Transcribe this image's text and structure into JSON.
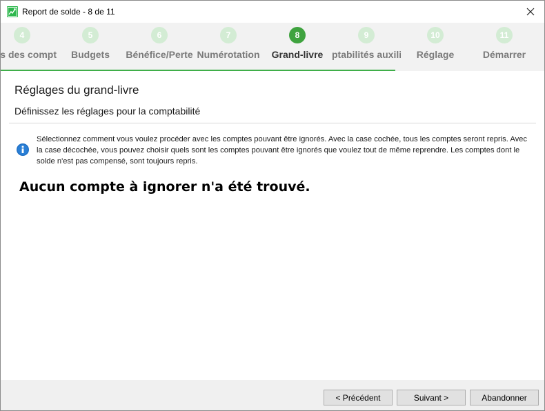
{
  "window": {
    "title": "Report de solde - 8 de 11",
    "icon": "chart-icon",
    "accent_color": "#3fae49"
  },
  "steps": [
    {
      "number": "4",
      "label": "s des compt",
      "state": "done"
    },
    {
      "number": "5",
      "label": "Budgets",
      "state": "done"
    },
    {
      "number": "6",
      "label": "Bénéfice/Perte",
      "state": "done"
    },
    {
      "number": "7",
      "label": "Numérotation",
      "state": "done"
    },
    {
      "number": "8",
      "label": "Grand-livre",
      "state": "active"
    },
    {
      "number": "9",
      "label": "ptabilités auxilia",
      "state": "pending"
    },
    {
      "number": "10",
      "label": "Réglage",
      "state": "pending"
    },
    {
      "number": "11",
      "label": "Démarrer",
      "state": "pending"
    }
  ],
  "content": {
    "heading": "Réglages du grand-livre",
    "subheading": "Définissez les réglages pour la comptabilité",
    "info_text": "Sélectionnez comment vous voulez procéder avec les comptes pouvant être ignorés. Avec la case cochée, tous les comptes seront repris. Avec la case décochée, vous pouvez choisir quels sont les comptes pouvant être ignorés que voulez tout de même reprendre. Les comptes dont le solde n'est pas compensé, sont toujours repris.",
    "empty_message": "Aucun compte à ignorer n'a été trouvé."
  },
  "footer": {
    "previous_label": "< Précédent",
    "next_label": "Suivant >",
    "cancel_label": "Abandonner"
  }
}
